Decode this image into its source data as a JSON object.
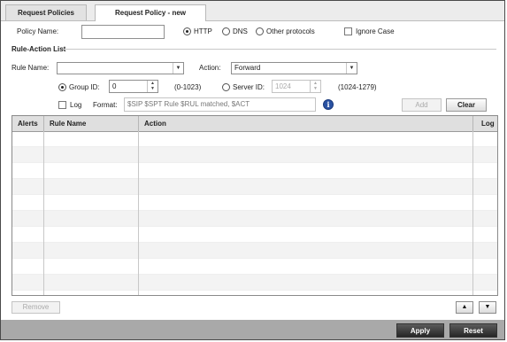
{
  "tabs": [
    {
      "label": "Request Policies",
      "active": false
    },
    {
      "label": "Request Policy - new",
      "active": true
    }
  ],
  "policy": {
    "name_label": "Policy Name:",
    "name_value": "",
    "protocols": [
      {
        "label": "HTTP",
        "selected": true
      },
      {
        "label": "DNS",
        "selected": false
      },
      {
        "label": "Other protocols",
        "selected": false
      }
    ],
    "ignore_case_label": "Ignore Case",
    "ignore_case_checked": false
  },
  "rule_action": {
    "section_title": "Rule-Action List",
    "rule_name_label": "Rule Name:",
    "rule_name_value": "",
    "action_label": "Action:",
    "action_value": "Forward",
    "group_id_label": "Group ID:",
    "group_id_value": "0",
    "group_id_range": "(0-1023)",
    "server_id_label": "Server ID:",
    "server_id_value": "1024",
    "server_id_range": "(1024-1279)",
    "log_label": "Log",
    "format_label": "Format:",
    "format_value": "$SIP $SPT Rule $RUL matched, $ACT",
    "info_icon": "i",
    "add_label": "Add",
    "clear_label": "Clear"
  },
  "table": {
    "columns": [
      "Alerts",
      "Rule Name",
      "Action",
      "Log"
    ],
    "rows": []
  },
  "remove_label": "Remove",
  "move_up_symbol": "▲",
  "move_down_symbol": "▼",
  "apply_label": "Apply",
  "reset_label": "Reset"
}
